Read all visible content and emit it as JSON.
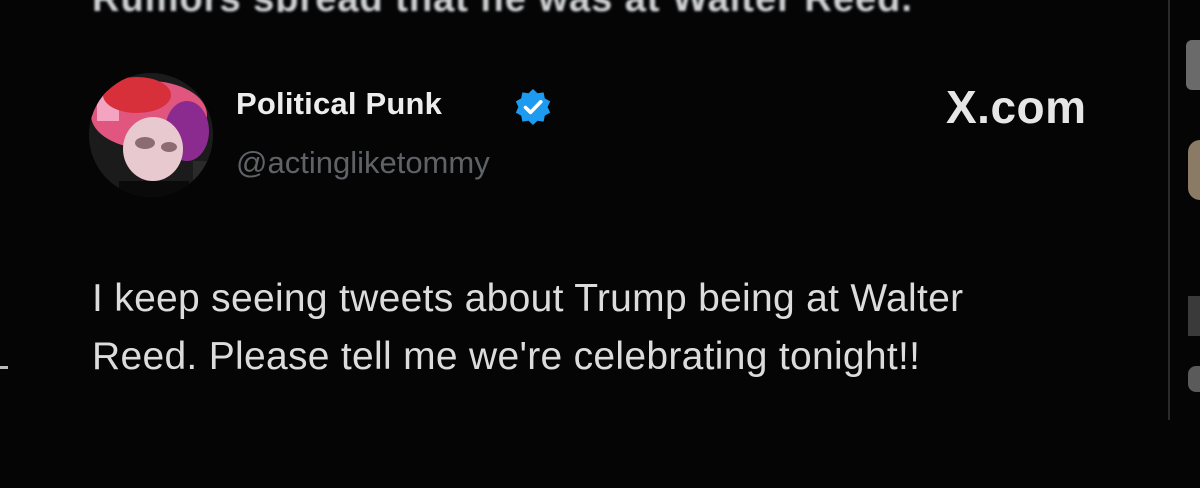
{
  "page": {
    "top_cut_text": "Rumors spread that he was at Walter Reed."
  },
  "tweet": {
    "author": {
      "display_name": "Political Punk",
      "handle": "@actingliketommy",
      "verified": true
    },
    "source_label": "X.com",
    "text_lines": [
      "I keep seeing tweets about Trump being at Walter",
      "Reed. Please tell me we're celebrating tonight!!"
    ]
  },
  "colors": {
    "background": "#050505",
    "verified_badge": "#1d9bf0",
    "handle": "#5f6266",
    "text": "#dcdcdc"
  },
  "icons": {
    "verified": "verified-badge-icon",
    "avatar": "avatar-image"
  }
}
